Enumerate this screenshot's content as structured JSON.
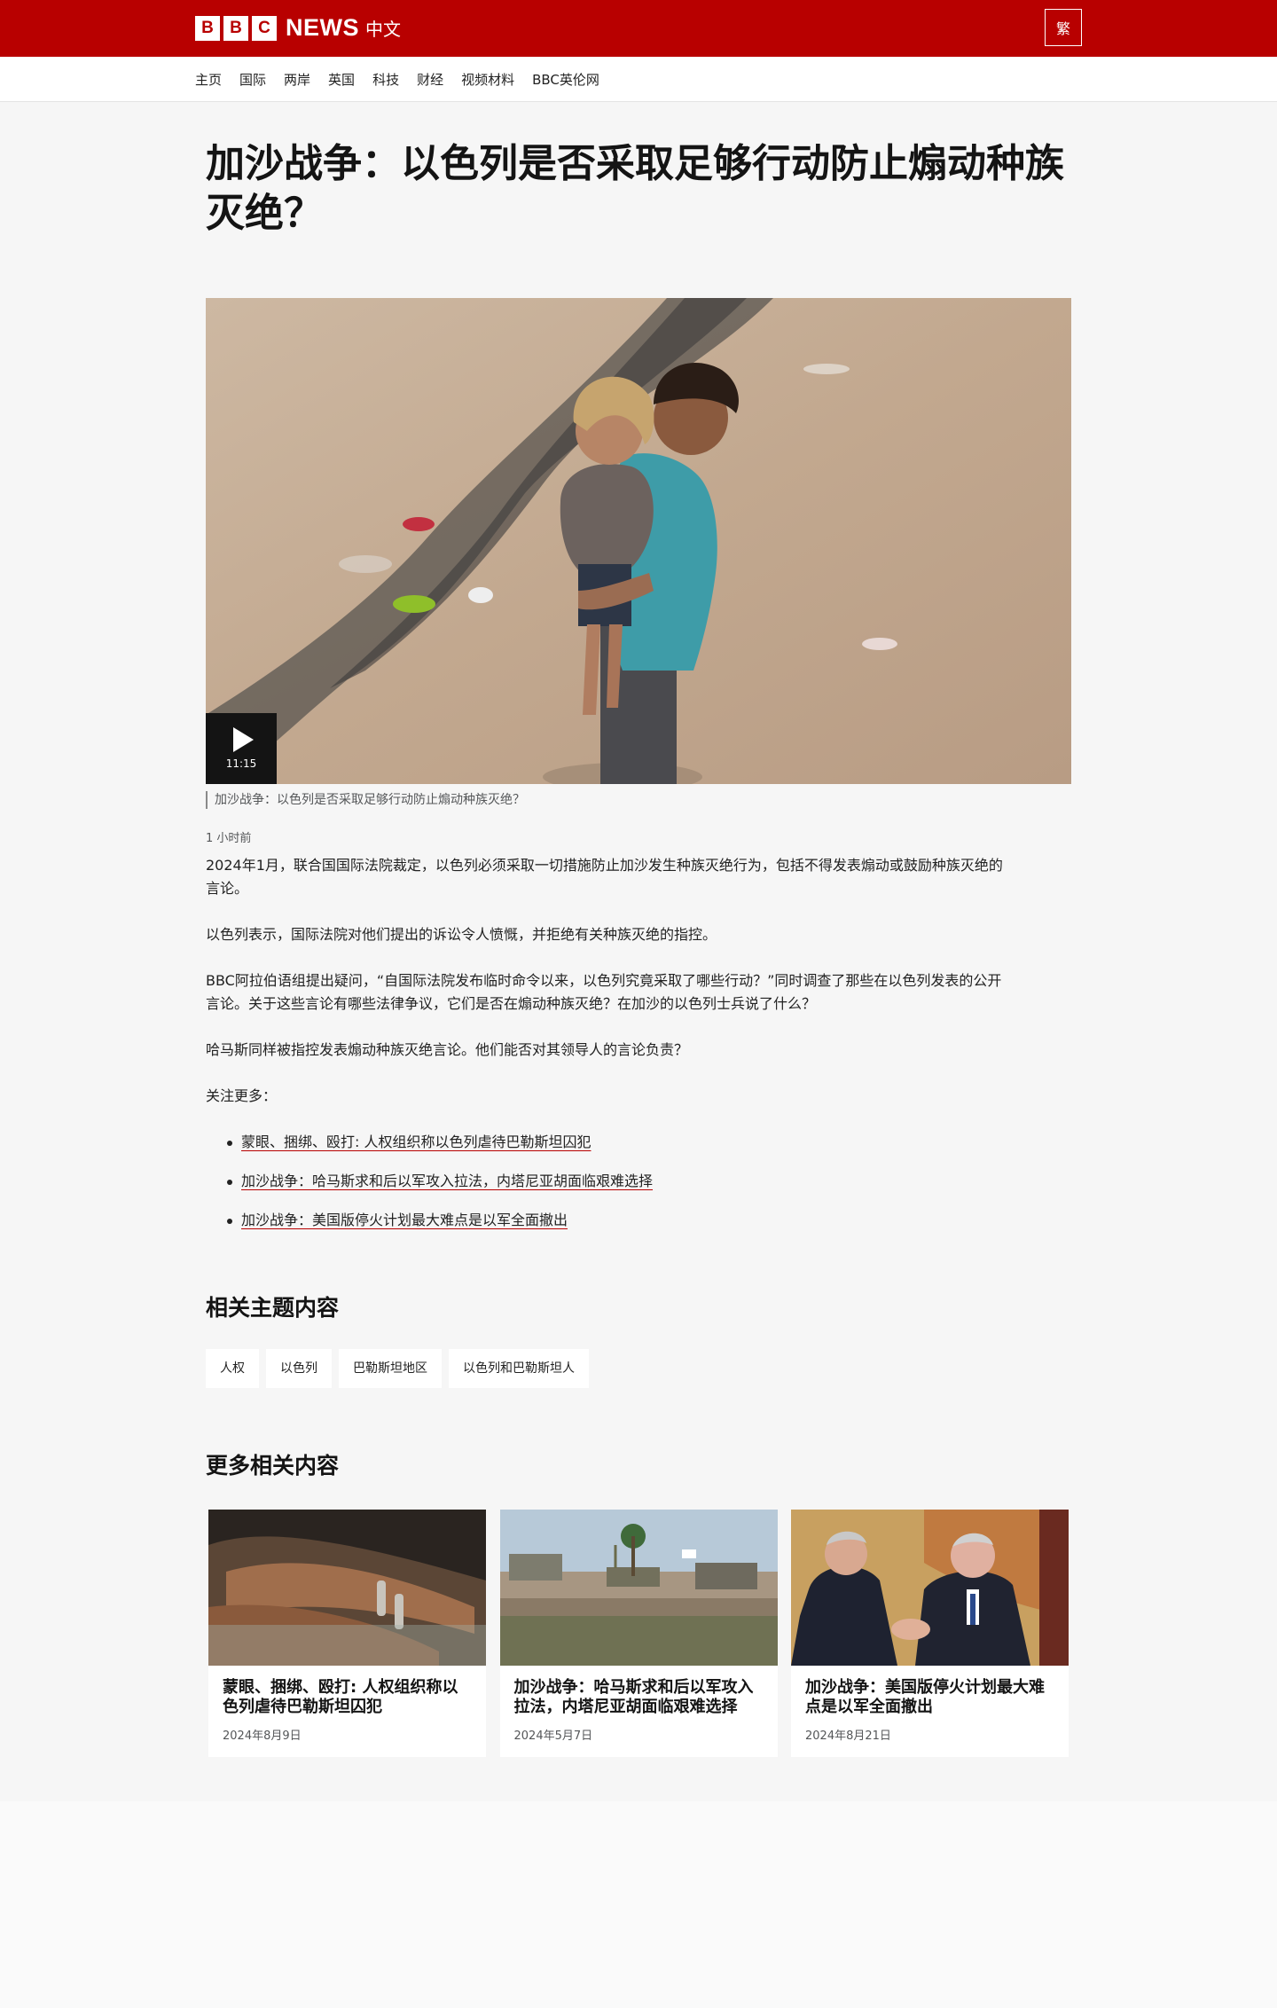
{
  "header": {
    "logo_letters": [
      "B",
      "B",
      "C"
    ],
    "logo_news": "NEWS",
    "logo_lang": "中文",
    "variant_button": "繁",
    "brand_color": "#b80000"
  },
  "nav": {
    "items": [
      "主页",
      "国际",
      "两岸",
      "英国",
      "科技",
      "财经",
      "视频材料",
      "BBC英伦网"
    ]
  },
  "article": {
    "title": "加沙战争：以色列是否采取足够行动防止煽动种族灭绝？",
    "video": {
      "duration": "11:15",
      "play_icon": "play-icon",
      "caption": "加沙战争：以色列是否采取足够行动防止煽动种族灭绝？"
    },
    "timestamp": "1 小时前",
    "paragraphs": [
      "2024年1月，联合国国际法院裁定，以色列必须采取一切措施防止加沙发生种族灭绝行为，包括不得发表煽动或鼓励种族灭绝的言论。",
      "以色列表示，国际法院对他们提出的诉讼令人愤慨，并拒绝有关种族灭绝的指控。",
      "BBC阿拉伯语组提出疑问，“自国际法院发布临时命令以来，以色列究竟采取了哪些行动？”同时调查了那些在以色列发表的公开言论。关于这些言论有哪些法律争议，它们是否在煽动种族灭绝？在加沙的以色列士兵说了什么？",
      "哈马斯同样被指控发表煽动种族灭绝言论。他们能否对其领导人的言论负责？",
      "关注更多："
    ],
    "related_links": [
      "蒙眼、捆绑、殴打: 人权组织称以色列虐待巴勒斯坦囚犯",
      "加沙战争：哈马斯求和后以军攻入拉法，内塔尼亚胡面临艰难选择",
      "加沙战争：美国版停火计划最大难点是以军全面撤出"
    ]
  },
  "topics": {
    "title": "相关主题内容",
    "tags": [
      "人权",
      "以色列",
      "巴勒斯坦地区",
      "以色列和巴勒斯坦人"
    ]
  },
  "more": {
    "title": "更多相关内容",
    "cards": [
      {
        "title": "蒙眼、捆绑、殴打: 人权组织称以色列虐待巴勒斯坦囚犯",
        "date": "2024年8月9日"
      },
      {
        "title": "加沙战争：哈马斯求和后以军攻入拉法，内塔尼亚胡面临艰难选择",
        "date": "2024年5月7日"
      },
      {
        "title": "加沙战争：美国版停火计划最大难点是以军全面撤出",
        "date": "2024年8月21日"
      }
    ]
  }
}
